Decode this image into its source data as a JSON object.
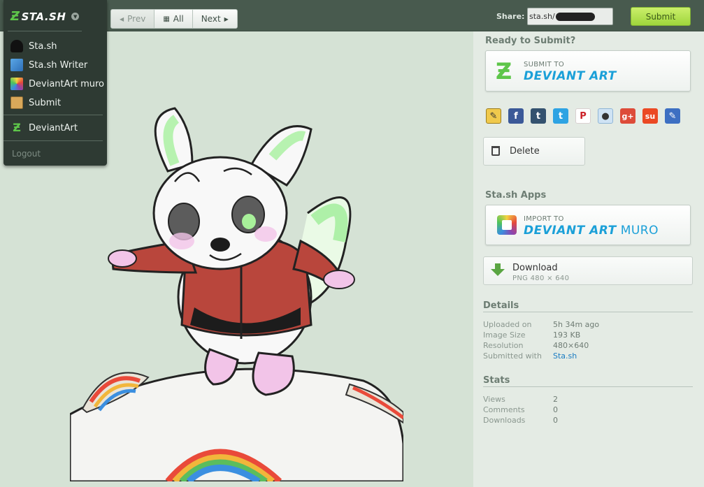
{
  "topbar": {
    "nav": {
      "prev": "Prev",
      "all": "All",
      "next": "Next"
    },
    "share_label": "Share:",
    "share_url": "sta.sh/",
    "submit_label": "Submit"
  },
  "menu": {
    "logo": "STA.SH",
    "items": [
      {
        "label": "Sta.sh",
        "icon": "avatar-icon"
      },
      {
        "label": "Sta.sh Writer",
        "icon": "writer-icon"
      },
      {
        "label": "DeviantArt muro",
        "icon": "muro-icon"
      },
      {
        "label": "Submit",
        "icon": "submit-icon"
      },
      {
        "label": "DeviantArt",
        "icon": "deviantart-icon"
      }
    ],
    "logout": "Logout"
  },
  "sidebar": {
    "ready_title": "Ready to Submit?",
    "submit_to": {
      "small": "SUBMIT TO",
      "big": "DEVIANT ART"
    },
    "social_icons": [
      "note-icon",
      "facebook-icon",
      "tumblr-icon",
      "twitter-icon",
      "pinterest-icon",
      "reddit-icon",
      "googleplus-icon",
      "stumbleupon-icon",
      "edit-icon"
    ],
    "delete_label": "Delete",
    "apps_title": "Sta.sh Apps",
    "import_to": {
      "small": "IMPORT TO",
      "big": "DEVIANT ART",
      "muro": "MURO"
    },
    "download": {
      "label": "Download",
      "sub": "PNG 480 × 640"
    },
    "details_title": "Details",
    "details": [
      {
        "key": "Uploaded on",
        "value": "5h 34m ago"
      },
      {
        "key": "Image Size",
        "value": "193 KB"
      },
      {
        "key": "Resolution",
        "value": "480×640"
      },
      {
        "key": "Submitted with",
        "value": "Sta.sh"
      }
    ],
    "stats_title": "Stats",
    "stats": [
      {
        "key": "Views",
        "value": "2"
      },
      {
        "key": "Comments",
        "value": "0"
      },
      {
        "key": "Downloads",
        "value": "0"
      }
    ]
  },
  "colors": {
    "accent_green": "#a8dc46",
    "deviantart_blue": "#1ba0d8",
    "topbar": "#485a4e",
    "background": "#d5e2d5"
  }
}
